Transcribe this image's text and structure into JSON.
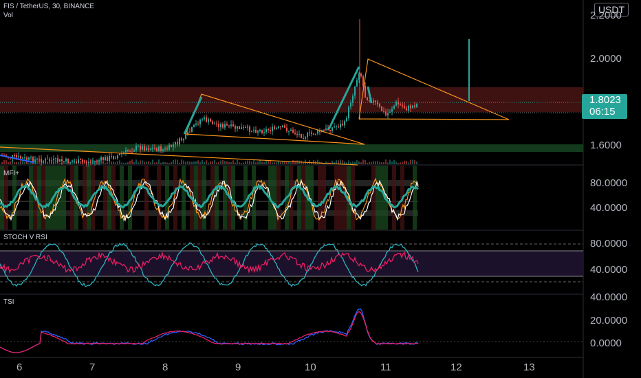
{
  "header": {
    "symbol": "FIS / TetherUS, 30, BINANCE",
    "volume_label": "Vol"
  },
  "price_scale": {
    "currency": "USDT",
    "labels": [
      "2.2000",
      "2.0000",
      "1.6000"
    ]
  },
  "last_price": {
    "value": "1.8023",
    "countdown": "06:15"
  },
  "panes": [
    {
      "name": "MFI+",
      "labels": [
        "80.0000",
        "40.0000"
      ]
    },
    {
      "name": "STOCH V RSI",
      "labels": [
        "80.0000",
        "40.0000"
      ]
    },
    {
      "name": "TSI",
      "labels": [
        "40.0000",
        "20.0000",
        "0.0000"
      ]
    }
  ],
  "time_axis": [
    "6",
    "7",
    "8",
    "9",
    "10",
    "11",
    "12",
    "13"
  ],
  "colors": {
    "up": "#26a69a",
    "down": "#ef5350",
    "trendline": "#f7931a",
    "resistance_zone": "#4a1515",
    "support_zone": "#133a1c",
    "stoch_k": "#2bb3c0",
    "stoch_d": "#e91e63",
    "tsi": "#2962ff",
    "tsi_signal": "#e91e63",
    "mfi": "#ffffff",
    "mfi_fast": "#f7931a"
  }
}
